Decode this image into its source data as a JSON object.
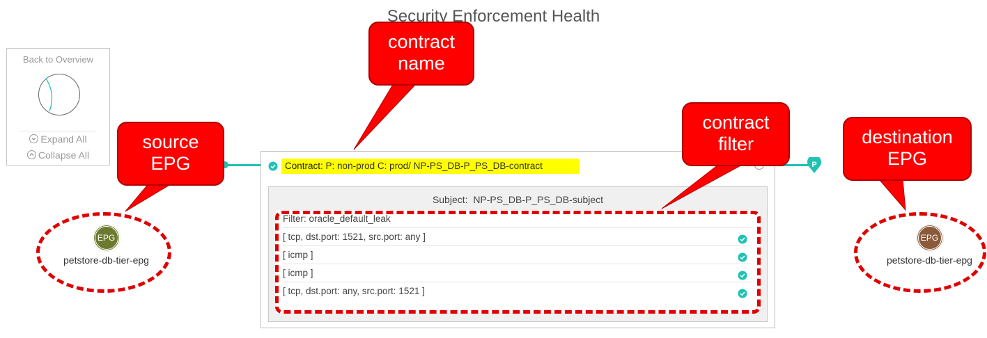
{
  "page_title": "Security Enforcement Health",
  "overview": {
    "back_label": "Back to Overview",
    "expand_label": "Expand All",
    "collapse_label": "Collapse All"
  },
  "contract": {
    "label": "Contract:",
    "value": "P: non-prod C: prod/ NP-PS_DB-P_PS_DB-contract",
    "status_icon": "check-circle-icon",
    "subject_label": "Subject:",
    "subject_value": "NP-PS_DB-P_PS_DB-subject",
    "filter_label": "Filter:",
    "filter_value": "oracle_default_leak",
    "filter_entries": [
      "[ tcp, dst.port: 1521, src.port: any ]",
      "[ icmp ]",
      "[ icmp ]",
      "[ tcp, dst.port: any, src.port: 1521 ]"
    ]
  },
  "provider_marker": "P",
  "source_epg": {
    "badge": "EPG",
    "name": "petstore-db-tier-epg",
    "color": "#6b7a2e"
  },
  "destination_epg": {
    "badge": "EPG",
    "name": "petstore-db-tier-epg",
    "color": "#8a5a3b"
  },
  "callouts": {
    "contract_name": [
      "contract",
      "name"
    ],
    "source": [
      "source",
      "EPG"
    ],
    "contract_filter": [
      "contract",
      "filter"
    ],
    "destination": [
      "destination",
      "EPG"
    ]
  },
  "colors": {
    "accent": "#1fc2b3",
    "highlight": "#ffff00",
    "callout": "#ff0000"
  }
}
